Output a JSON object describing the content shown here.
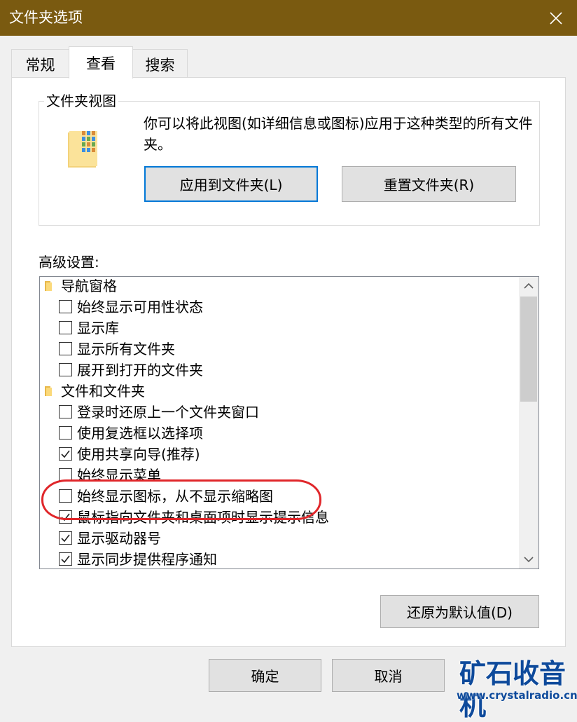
{
  "window": {
    "title": "文件夹选项"
  },
  "tabs": [
    {
      "label": "常规",
      "active": false
    },
    {
      "label": "查看",
      "active": true
    },
    {
      "label": "搜索",
      "active": false
    }
  ],
  "folder_views": {
    "group_label": "文件夹视图",
    "description": "你可以将此视图(如详细信息或图标)应用于这种类型的所有文件夹。",
    "apply_button": "应用到文件夹(L)",
    "reset_button": "重置文件夹(R)"
  },
  "advanced": {
    "label": "高级设置:",
    "items": [
      {
        "type": "folder",
        "label": "导航窗格"
      },
      {
        "type": "checkbox",
        "label": "始终显示可用性状态",
        "checked": false
      },
      {
        "type": "checkbox",
        "label": "显示库",
        "checked": false
      },
      {
        "type": "checkbox",
        "label": "显示所有文件夹",
        "checked": false
      },
      {
        "type": "checkbox",
        "label": "展开到打开的文件夹",
        "checked": false
      },
      {
        "type": "folder",
        "label": "文件和文件夹"
      },
      {
        "type": "checkbox",
        "label": "登录时还原上一个文件夹窗口",
        "checked": false
      },
      {
        "type": "checkbox",
        "label": "使用复选框以选择项",
        "checked": false
      },
      {
        "type": "checkbox",
        "label": "使用共享向导(推荐)",
        "checked": true
      },
      {
        "type": "checkbox",
        "label": "始终显示菜单",
        "checked": false
      },
      {
        "type": "checkbox",
        "label": "始终显示图标，从不显示缩略图",
        "checked": false
      },
      {
        "type": "checkbox",
        "label": "鼠标指向文件夹和桌面项时显示提示信息",
        "checked": true
      },
      {
        "type": "checkbox",
        "label": "显示驱动器号",
        "checked": true
      },
      {
        "type": "checkbox",
        "label": "显示同步提供程序通知",
        "checked": true
      }
    ],
    "restore_button": "还原为默认值(D)"
  },
  "footer": {
    "ok_button": "确定",
    "cancel_button": "取消"
  },
  "watermark": {
    "text_cn": "矿石收音机",
    "text_url": "www.crystalradio.cn"
  },
  "colors": {
    "titlebar": "#7a5a10",
    "focus_border": "#0078d7",
    "highlight_ellipse": "#e0262a",
    "watermark": "#0e4a9b"
  }
}
